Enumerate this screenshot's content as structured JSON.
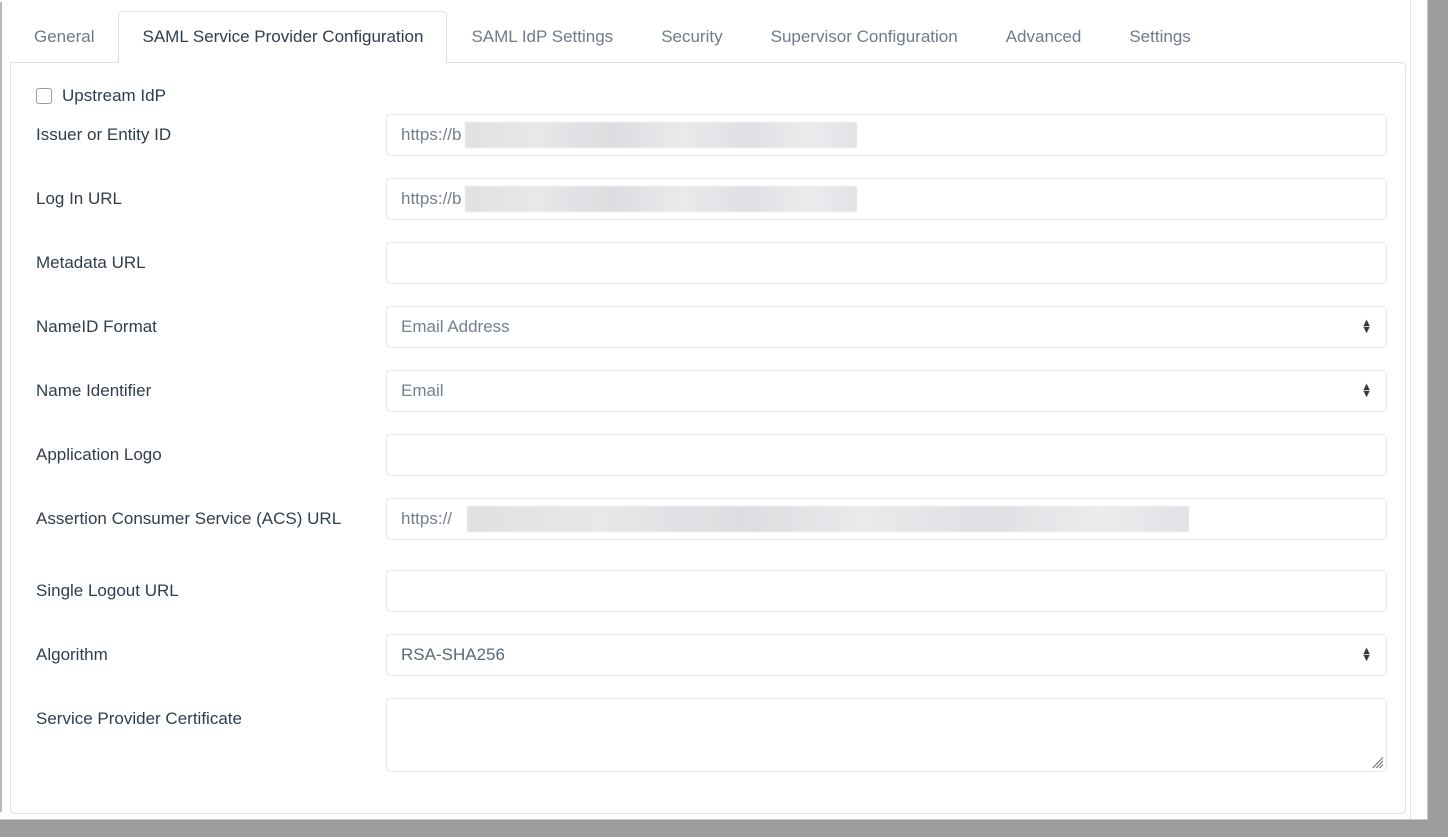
{
  "window": {
    "scrollbar_present": true
  },
  "tabs": [
    {
      "label": "General",
      "active": false
    },
    {
      "label": "SAML Service Provider Configuration",
      "active": true
    },
    {
      "label": "SAML IdP Settings",
      "active": false
    },
    {
      "label": "Security",
      "active": false
    },
    {
      "label": "Supervisor Configuration",
      "active": false
    },
    {
      "label": "Advanced",
      "active": false
    },
    {
      "label": "Settings",
      "active": false
    }
  ],
  "form": {
    "upstream_idp": {
      "label": "Upstream IdP",
      "checked": false
    },
    "fields": [
      {
        "label": "Issuer or Entity ID",
        "type": "text",
        "value": "https://b",
        "redacted": true
      },
      {
        "label": "Log In URL",
        "type": "text",
        "value": "https://b",
        "redacted": true
      },
      {
        "label": "Metadata URL",
        "type": "text",
        "value": "",
        "redacted": false
      },
      {
        "label": "NameID Format",
        "type": "select",
        "value": "Email Address",
        "redacted": false
      },
      {
        "label": "Name Identifier",
        "type": "select",
        "value": "Email",
        "redacted": false
      },
      {
        "label": "Application Logo",
        "type": "text",
        "value": "",
        "redacted": false
      },
      {
        "label": "Assertion Consumer Service (ACS) URL",
        "type": "text",
        "value": "https://",
        "redacted": true
      },
      {
        "label": "Single Logout URL",
        "type": "text",
        "value": "",
        "redacted": false
      },
      {
        "label": "Algorithm",
        "type": "select",
        "value": "RSA-SHA256",
        "redacted": false
      },
      {
        "label": "Service Provider Certificate",
        "type": "textarea",
        "value": "",
        "redacted": false
      }
    ]
  },
  "icons": {
    "select_up": "▲",
    "select_down": "▼"
  },
  "colors": {
    "panel_border": "#dcdfe3",
    "field_border": "#e6e8eb",
    "label_text": "#2f3d4d",
    "tab_inactive_text": "#6f7b8a",
    "placeholder_text": "#74808e",
    "frame_shadow": "#9d9d9d"
  }
}
